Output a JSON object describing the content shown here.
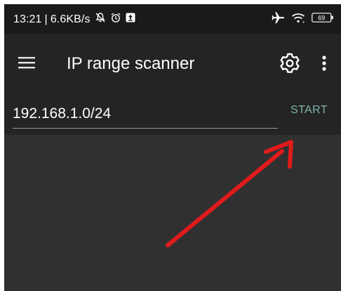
{
  "status_bar": {
    "time": "13:21",
    "separator": "|",
    "network_speed": "6.6KB/s",
    "battery_level": "69",
    "icons": [
      "notifications-muted-icon",
      "alarm-icon",
      "upload-notification-icon",
      "airplane-mode-icon",
      "wifi-icon",
      "battery-icon"
    ]
  },
  "toolbar": {
    "title": "IP range scanner",
    "icons": [
      "hamburger-menu-icon",
      "gear-icon",
      "more-vert-icon"
    ]
  },
  "scanner": {
    "ip_range_value": "192.168.1.0/24",
    "start_label": "START"
  },
  "annotation": {
    "arrow_color": "#e01b1b",
    "points_to": "start-button"
  },
  "colors": {
    "status_bar_bg": "#1a1a1a",
    "toolbar_bg": "#242424",
    "content_bg": "#303030",
    "accent": "#7fb3a8"
  }
}
